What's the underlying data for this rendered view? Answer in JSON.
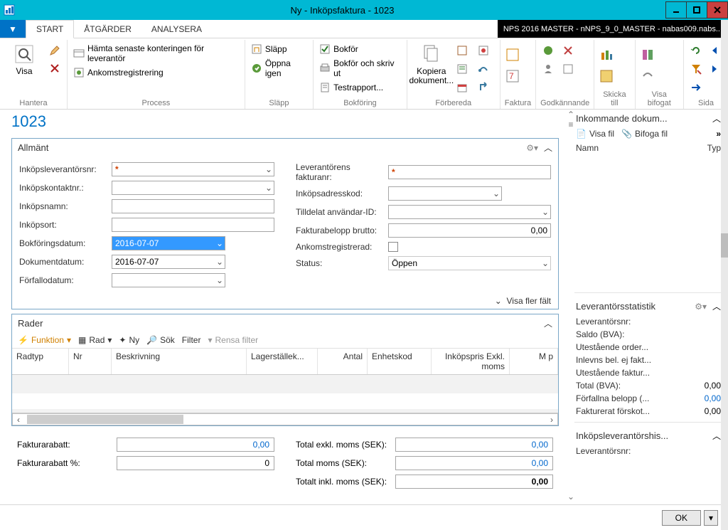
{
  "window": {
    "title": "Ny - Inköpsfaktura - 1023"
  },
  "tabs": {
    "file_arrow": "▼",
    "start": "START",
    "actions": "ÅTGÄRDER",
    "analyze": "ANALYSERA"
  },
  "envbar": "NPS 2016 MASTER - nNPS_9_0_MASTER - nabas009.nabs...",
  "ribbon": {
    "manage": {
      "label": "Hantera",
      "view": "Visa"
    },
    "process": {
      "label": "Process",
      "b1": "Hämta senaste konteringen för leverantör",
      "b2": "Ankomstregistrering"
    },
    "release": {
      "label": "Släpp",
      "b1": "Släpp",
      "b2": "Öppna igen"
    },
    "posting": {
      "label": "Bokföring",
      "b1": "Bokför",
      "b2": "Bokför och skriv ut",
      "b3": "Testrapport..."
    },
    "prepare": {
      "label": "Förbereda",
      "copy": "Kopiera dokument..."
    },
    "invoice": {
      "label": "Faktura"
    },
    "approve": {
      "label": "Godkännande"
    },
    "sendto": {
      "label": "Skicka till"
    },
    "attached": {
      "label": "Visa bifogat"
    },
    "page": {
      "label": "Sida"
    }
  },
  "doc": {
    "title": "1023"
  },
  "general": {
    "header": "Allmänt",
    "left": {
      "l1": "Inköpsleverantörsnr:",
      "l2": "Inköpskontaktnr.:",
      "l3": "Inköpsnamn:",
      "l4": "Inköpsort:",
      "l5": "Bokföringsdatum:",
      "l6": "Dokumentdatum:",
      "l7": "Förfallodatum:",
      "v5": "2016-07-07",
      "v6": "2016-07-07"
    },
    "right": {
      "r1": "Leverantörens fakturanr:",
      "r2": "Inköpsadresskod:",
      "r3": "Tilldelat användar-ID:",
      "r4": "Fakturabelopp brutto:",
      "r5": "Ankomstregistrerad:",
      "r6": "Status:",
      "v4": "0,00",
      "v6": "Öppen"
    },
    "showmore": "Visa fler fält"
  },
  "lines": {
    "header": "Rader",
    "toolbar": {
      "func": "Funktion",
      "row": "Rad",
      "new": "Ny",
      "find": "Sök",
      "filter": "Filter",
      "clear": "Rensa filter"
    },
    "cols": {
      "c1": "Radtyp",
      "c2": "Nr",
      "c3": "Beskrivning",
      "c4": "Lagerställek...",
      "c5": "Antal",
      "c6": "Enhetskod",
      "c7": "Inköpspris Exkl. moms",
      "c8": "M p"
    }
  },
  "totals": {
    "l1": "Fakturarabatt:",
    "v1": "0,00",
    "l2": "Fakturarabatt %:",
    "v2": "0",
    "r1": "Total exkl. moms (SEK):",
    "rv1": "0,00",
    "r2": "Total moms (SEK):",
    "rv2": "0,00",
    "r3": "Totalt inkl. moms (SEK):",
    "rv3": "0,00"
  },
  "side": {
    "incoming": {
      "title": "Inkommande dokum...",
      "viewfile": "Visa fil",
      "attach": "Bifoga fil",
      "colName": "Namn",
      "colType": "Typ"
    },
    "stats": {
      "title": "Leverantörsstatistik",
      "k1": "Leverantörsnr:",
      "k2": "Saldo (BVA):",
      "k3": "Utestående order...",
      "k4": "Inlevns bel. ej fakt...",
      "k5": "Utestående faktur...",
      "k6": "Total (BVA):",
      "v6": "0,00",
      "k7": "Förfallna belopp (...",
      "v7": "0,00",
      "k8": "Fakturerat förskot...",
      "v8": "0,00"
    },
    "hist": {
      "title": "Inköpsleverantörshis...",
      "k1": "Leverantörsnr:"
    }
  },
  "footer": {
    "ok": "OK"
  }
}
